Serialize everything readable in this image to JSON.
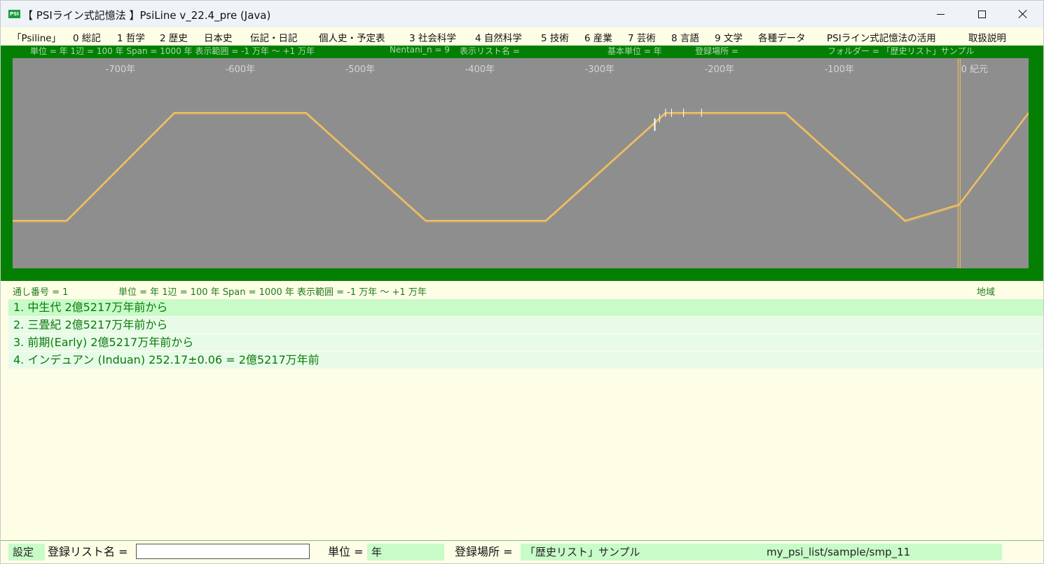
{
  "window": {
    "icon_text": "PSI",
    "title": "【 PSIライン式記憶法 】PsiLine v_22.4_pre (Java)"
  },
  "menu": [
    "「Psiline」",
    "0 総記",
    "1 哲学",
    "2 歴史",
    "日本史",
    "伝記・日記",
    "個人史・予定表",
    "3 社会科学",
    "4 自然科学",
    "5 技術",
    "6 産業",
    "7 芸術",
    "8 言語",
    "9 文学",
    "各種データ",
    "PSIライン式記憶法の活用",
    "取扱説明"
  ],
  "chart_info": {
    "scale": "単位 = 年  1辺 = 100 年  Span = 1000 年  表示範囲 = -1 万年 〜 +1 万年",
    "nentani": "Nentani_n = 9",
    "list_name": "表示リスト名 =",
    "base_unit": "基本単位 = 年",
    "location": "登録場所 =",
    "folder": "フォルダー = 「歴史リスト」サンプル"
  },
  "chart_data": {
    "type": "line",
    "xlabel": "",
    "ylabel": "",
    "xlim": [
      -790,
      58
    ],
    "ticks": [
      {
        "value": -700,
        "label": "-700年"
      },
      {
        "value": -600,
        "label": "-600年"
      },
      {
        "value": -500,
        "label": "-500年"
      },
      {
        "value": -400,
        "label": "-400年"
      },
      {
        "value": -300,
        "label": "-300年"
      },
      {
        "value": -200,
        "label": "-200年"
      },
      {
        "value": -100,
        "label": "-100年"
      },
      {
        "value": 0,
        "label": "0 紀元"
      }
    ],
    "series": [
      {
        "x": [
          -790,
          -745,
          -655,
          -545,
          -445,
          -345,
          -245,
          -145,
          -45,
          0,
          58
        ],
        "y": [
          0,
          0,
          1,
          1,
          0,
          0,
          1,
          1,
          0,
          0.15,
          1
        ]
      }
    ],
    "markers": [
      -254,
      -250,
      -245,
      -240,
      -230,
      -215
    ],
    "epoch_marker": 0,
    "line_color": "#f2c15a",
    "background": "#8e8e8e",
    "frame_color": "#038003",
    "grid": false
  },
  "list": {
    "serial": "通し番号 = 1",
    "scale": "単位 = 年  1辺 = 100 年  Span = 1000 年  表示範囲 = -1 万年 〜 +1 万年",
    "region": "地域",
    "items": [
      "1. 中生代 2億5217万年前から",
      "2. 三畳紀 2億5217万年前から",
      "3. 前期(Early) 2億5217万年前から",
      "4. インデュアン (Induan) 252.17±0.06 = 2億5217万年前"
    ]
  },
  "bottom": {
    "settings": "設定",
    "list_name_label": "登録リスト名 =",
    "list_name_value": "",
    "unit_label": "単位 =",
    "unit_value": "年",
    "location_label": "登録場所 =",
    "location_value": "「歴史リスト」サンプル",
    "path_value": "my_psi_list/sample/smp_11"
  }
}
